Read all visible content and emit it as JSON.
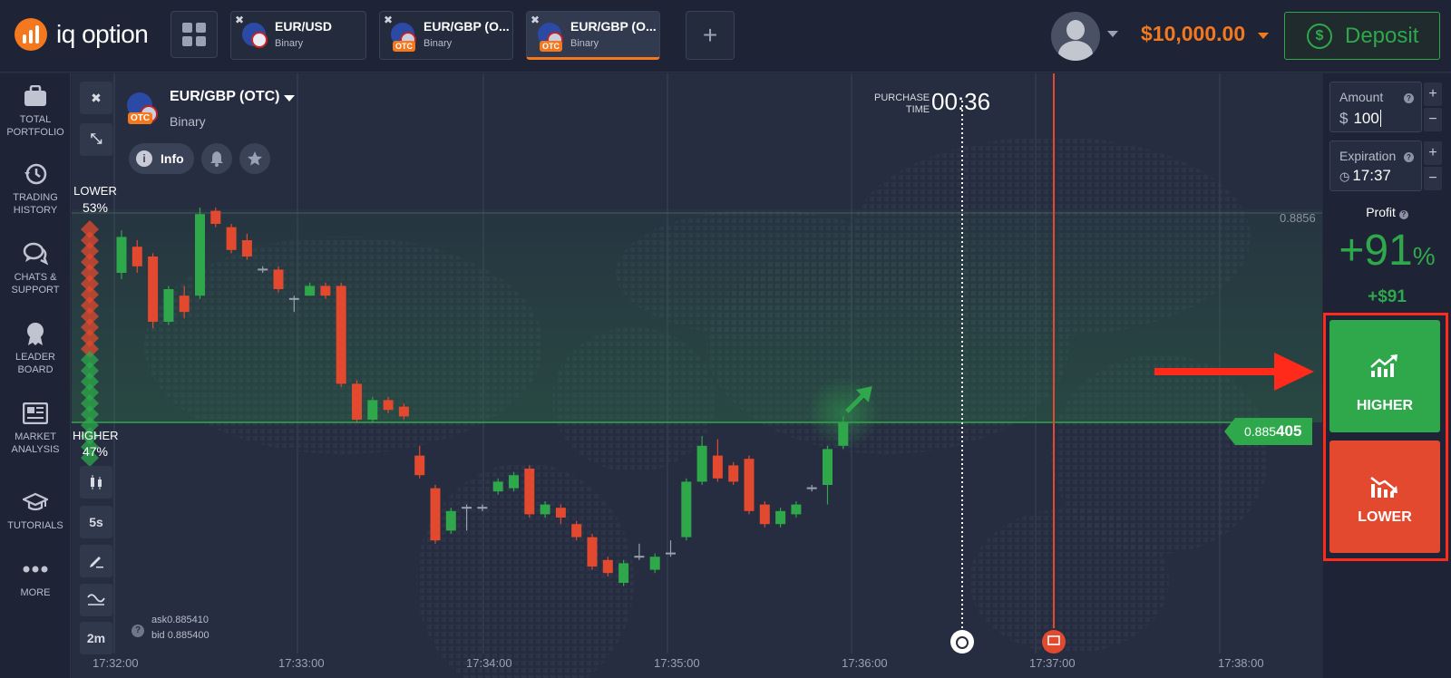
{
  "brand": {
    "logo_text": "iq option",
    "accent": "#f3781e"
  },
  "tabs": [
    {
      "name": "EUR/USD",
      "sub": "Binary",
      "otc": ""
    },
    {
      "name": "EUR/GBP (O...",
      "sub": "Binary",
      "otc": "OTC"
    },
    {
      "name": "EUR/GBP (O...",
      "sub": "Binary",
      "otc": "OTC"
    }
  ],
  "header": {
    "balance": "$10,000.00",
    "deposit_label": "Deposit",
    "deposit_icon": "$"
  },
  "sidebar": [
    {
      "icon": "briefcase-icon",
      "label1": "TOTAL",
      "label2": "PORTFOLIO"
    },
    {
      "icon": "history-icon",
      "label1": "TRADING",
      "label2": "HISTORY"
    },
    {
      "icon": "chat-icon",
      "label1": "CHATS &",
      "label2": "SUPPORT"
    },
    {
      "icon": "medal-icon",
      "label1": "LEADER",
      "label2": "BOARD"
    },
    {
      "icon": "newspaper-icon",
      "label1": "MARKET",
      "label2": "ANALYSIS"
    },
    {
      "icon": "graduation-cap-icon",
      "label1": "TUTORIALS",
      "label2": ""
    },
    {
      "icon": "more-icon",
      "label1": "MORE",
      "label2": ""
    }
  ],
  "asset": {
    "title": "EUR/GBP (OTC)",
    "type": "Binary",
    "otc": "OTC",
    "info_label": "Info",
    "info_icon": "i"
  },
  "sentiment": {
    "lower_label": "LOWER",
    "lower_pct": "53%",
    "higher_label": "HIGHER",
    "higher_pct": "47%"
  },
  "tools": {
    "interval": "5s",
    "period": "2m"
  },
  "purchase": {
    "label1": "PURCHASE",
    "label2": "TIME",
    "countdown": "00:36"
  },
  "price": {
    "current_prefix": "0.885",
    "current_suffix": "405",
    "axis_level": "0.8856",
    "ask": "ask0.885410",
    "bid": "bid 0.885400",
    "help": "?"
  },
  "time_axis": [
    "17:32:00",
    "17:33:00",
    "17:34:00",
    "17:35:00",
    "17:36:00",
    "17:37:00",
    "17:38:00"
  ],
  "trade": {
    "amount_label": "Amount",
    "amount_currency": "$",
    "amount_value": "100",
    "expiration_label": "Expiration",
    "expiration_value": "17:37",
    "profit_label": "Profit",
    "profit_pct": "+91",
    "profit_pct_sign": "%",
    "profit_usd": "+$91",
    "higher_label": "HIGHER",
    "lower_label": "LOWER",
    "plus": "+",
    "minus": "−",
    "help": "?"
  },
  "colors": {
    "up": "#2ea84b",
    "down": "#e3492f",
    "highlight": "#ff2a1a"
  },
  "chart_data": {
    "type": "candlestick",
    "xlabel": "",
    "ylabel": "",
    "candles": [
      {
        "o": 0.8855,
        "c": 0.88561,
        "h": 0.88563,
        "l": 0.88548
      },
      {
        "o": 0.88558,
        "c": 0.88552,
        "h": 0.8856,
        "l": 0.8855
      },
      {
        "o": 0.88555,
        "c": 0.88535,
        "h": 0.88556,
        "l": 0.88533
      },
      {
        "o": 0.88535,
        "c": 0.88545,
        "h": 0.88546,
        "l": 0.88534
      },
      {
        "o": 0.88543,
        "c": 0.88538,
        "h": 0.88546,
        "l": 0.88536
      },
      {
        "o": 0.88543,
        "c": 0.88568,
        "h": 0.8857,
        "l": 0.88542
      },
      {
        "o": 0.88569,
        "c": 0.88565,
        "h": 0.8857,
        "l": 0.88564
      },
      {
        "o": 0.88564,
        "c": 0.88557,
        "h": 0.88565,
        "l": 0.88556
      },
      {
        "o": 0.8856,
        "c": 0.88555,
        "h": 0.88562,
        "l": 0.88554
      },
      {
        "o": 0.88551,
        "c": 0.88551,
        "h": 0.88552,
        "l": 0.8855
      },
      {
        "o": 0.88551,
        "c": 0.88545,
        "h": 0.88552,
        "l": 0.88544
      },
      {
        "o": 0.88542,
        "c": 0.88542,
        "h": 0.88543,
        "l": 0.88538
      },
      {
        "o": 0.88543,
        "c": 0.88546,
        "h": 0.88547,
        "l": 0.88543
      },
      {
        "o": 0.88546,
        "c": 0.88543,
        "h": 0.88547,
        "l": 0.88542
      },
      {
        "o": 0.88546,
        "c": 0.88516,
        "h": 0.88547,
        "l": 0.88515
      },
      {
        "o": 0.88516,
        "c": 0.88505,
        "h": 0.88517,
        "l": 0.88504
      },
      {
        "o": 0.88505,
        "c": 0.88511,
        "h": 0.88512,
        "l": 0.88504
      },
      {
        "o": 0.88511,
        "c": 0.88508,
        "h": 0.88512,
        "l": 0.88507
      },
      {
        "o": 0.88509,
        "c": 0.88506,
        "h": 0.8851,
        "l": 0.88505
      },
      {
        "o": 0.88494,
        "c": 0.88488,
        "h": 0.88497,
        "l": 0.88487
      },
      {
        "o": 0.88484,
        "c": 0.88468,
        "h": 0.88485,
        "l": 0.88467
      },
      {
        "o": 0.88471,
        "c": 0.88477,
        "h": 0.88478,
        "l": 0.8847
      },
      {
        "o": 0.88478,
        "c": 0.88478,
        "h": 0.88479,
        "l": 0.88471
      },
      {
        "o": 0.88478,
        "c": 0.88478,
        "h": 0.88479,
        "l": 0.88477
      },
      {
        "o": 0.88483,
        "c": 0.88486,
        "h": 0.88487,
        "l": 0.88482
      },
      {
        "o": 0.88484,
        "c": 0.88488,
        "h": 0.88489,
        "l": 0.88483
      },
      {
        "o": 0.8849,
        "c": 0.88476,
        "h": 0.88491,
        "l": 0.88475
      },
      {
        "o": 0.88476,
        "c": 0.88479,
        "h": 0.8848,
        "l": 0.88475
      },
      {
        "o": 0.88478,
        "c": 0.88475,
        "h": 0.88479,
        "l": 0.88473
      },
      {
        "o": 0.88473,
        "c": 0.88469,
        "h": 0.88474,
        "l": 0.88468
      },
      {
        "o": 0.88469,
        "c": 0.8846,
        "h": 0.8847,
        "l": 0.88459
      },
      {
        "o": 0.88462,
        "c": 0.88458,
        "h": 0.88463,
        "l": 0.88457
      },
      {
        "o": 0.88455,
        "c": 0.88461,
        "h": 0.88462,
        "l": 0.88454
      },
      {
        "o": 0.88463,
        "c": 0.88463,
        "h": 0.88467,
        "l": 0.88462
      },
      {
        "o": 0.88459,
        "c": 0.88463,
        "h": 0.88464,
        "l": 0.88458
      },
      {
        "o": 0.88464,
        "c": 0.88464,
        "h": 0.88468,
        "l": 0.88463
      },
      {
        "o": 0.88469,
        "c": 0.88486,
        "h": 0.88487,
        "l": 0.88468
      },
      {
        "o": 0.88486,
        "c": 0.88497,
        "h": 0.885,
        "l": 0.88485
      },
      {
        "o": 0.88494,
        "c": 0.88487,
        "h": 0.88499,
        "l": 0.88486
      },
      {
        "o": 0.88491,
        "c": 0.88486,
        "h": 0.88492,
        "l": 0.88485
      },
      {
        "o": 0.88493,
        "c": 0.88477,
        "h": 0.88494,
        "l": 0.88476
      },
      {
        "o": 0.88479,
        "c": 0.88473,
        "h": 0.8848,
        "l": 0.88472
      },
      {
        "o": 0.88473,
        "c": 0.88477,
        "h": 0.88478,
        "l": 0.88472
      },
      {
        "o": 0.88476,
        "c": 0.88479,
        "h": 0.8848,
        "l": 0.88475
      },
      {
        "o": 0.88484,
        "c": 0.88484,
        "h": 0.88485,
        "l": 0.88483
      },
      {
        "o": 0.88485,
        "c": 0.88496,
        "h": 0.88497,
        "l": 0.88479
      },
      {
        "o": 0.88497,
        "c": 0.88504,
        "h": 0.88506,
        "l": 0.88496
      }
    ]
  }
}
